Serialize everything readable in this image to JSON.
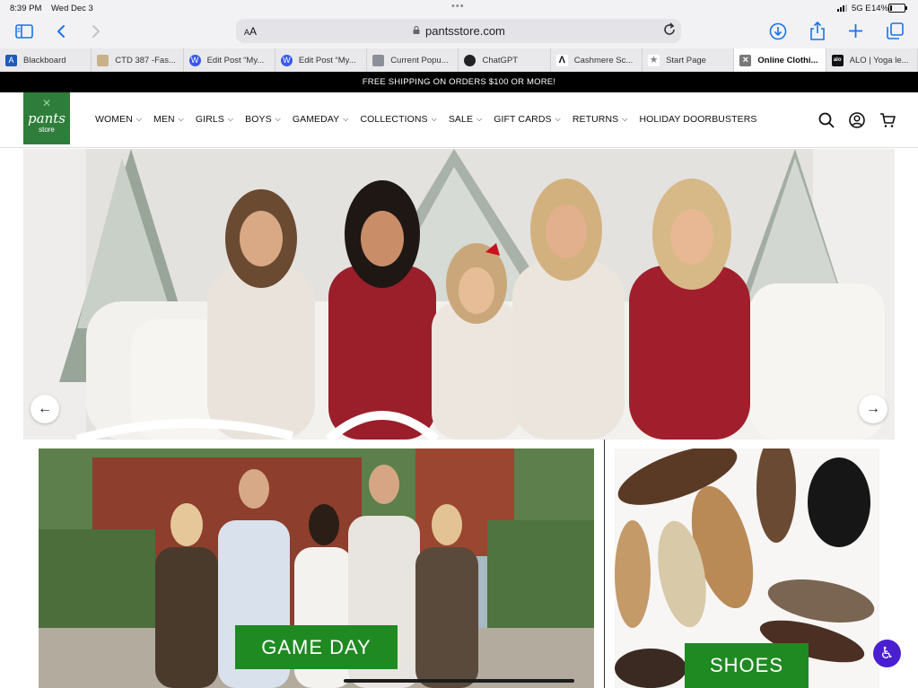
{
  "status_bar": {
    "time": "8:39 PM",
    "date": "Wed Dec 3",
    "network": "5G E",
    "battery": "14%",
    "battery_level": 0.14
  },
  "toolbar": {
    "text_size": "AA",
    "url": "pantsstore.com",
    "icons": [
      "sidebar-icon",
      "back-icon",
      "forward-icon",
      "reload-icon",
      "download-icon",
      "share-icon",
      "new-tab-icon",
      "tabs-overview-icon"
    ]
  },
  "tabs": [
    {
      "label": "Blackboard",
      "favicon": "A",
      "favicon_color": "#1e5bb8"
    },
    {
      "label": "CTD 387 -Fas...",
      "favicon": "",
      "favicon_color": "#c9b28a"
    },
    {
      "label": "Edit Post “My...",
      "favicon": "W",
      "favicon_color": "#3858e9"
    },
    {
      "label": "Edit Post “My...",
      "favicon": "W",
      "favicon_color": "#3858e9"
    },
    {
      "label": "Current Popu...",
      "favicon": "",
      "favicon_color": "#8a8f99"
    },
    {
      "label": "ChatGPT",
      "favicon": "",
      "favicon_color": "#222222"
    },
    {
      "label": "Cashmere Sc...",
      "favicon": "Λ",
      "favicon_color": "#ffffff"
    },
    {
      "label": "Start Page",
      "favicon": "★",
      "favicon_color": "#ffffff"
    },
    {
      "label": "Online Clothi...",
      "favicon": "×",
      "favicon_color": "#777777",
      "active": true
    },
    {
      "label": "ALO | Yoga le...",
      "favicon": "alo",
      "favicon_color": "#111111"
    }
  ],
  "site": {
    "promo": "FREE SHIPPING ON ORDERS $100 OR MORE!",
    "logo": {
      "word": "pants",
      "sub": "store"
    },
    "nav": [
      {
        "label": "WOMEN",
        "dropdown": true
      },
      {
        "label": "MEN",
        "dropdown": true
      },
      {
        "label": "GIRLS",
        "dropdown": true
      },
      {
        "label": "BOYS",
        "dropdown": true
      },
      {
        "label": "GAMEDAY",
        "dropdown": true
      },
      {
        "label": "COLLECTIONS",
        "dropdown": true
      },
      {
        "label": "SALE",
        "dropdown": true
      },
      {
        "label": "GIFT CARDS",
        "dropdown": true
      },
      {
        "label": "RETURNS",
        "dropdown": true
      },
      {
        "label": "HOLIDAY DOORBUSTERS",
        "dropdown": false
      }
    ],
    "header_icons": [
      "search-icon",
      "account-icon",
      "cart-icon"
    ],
    "hero": {
      "arrows": [
        "←",
        "→"
      ]
    },
    "tiles": {
      "gameday_label": "GAME DAY",
      "shoes_label": "SHOES"
    },
    "colors": {
      "brand_green": "#2f7d3a",
      "button_green": "#1f8a22",
      "promo_bg": "#000000",
      "link_blue": "#1a73e8"
    }
  }
}
